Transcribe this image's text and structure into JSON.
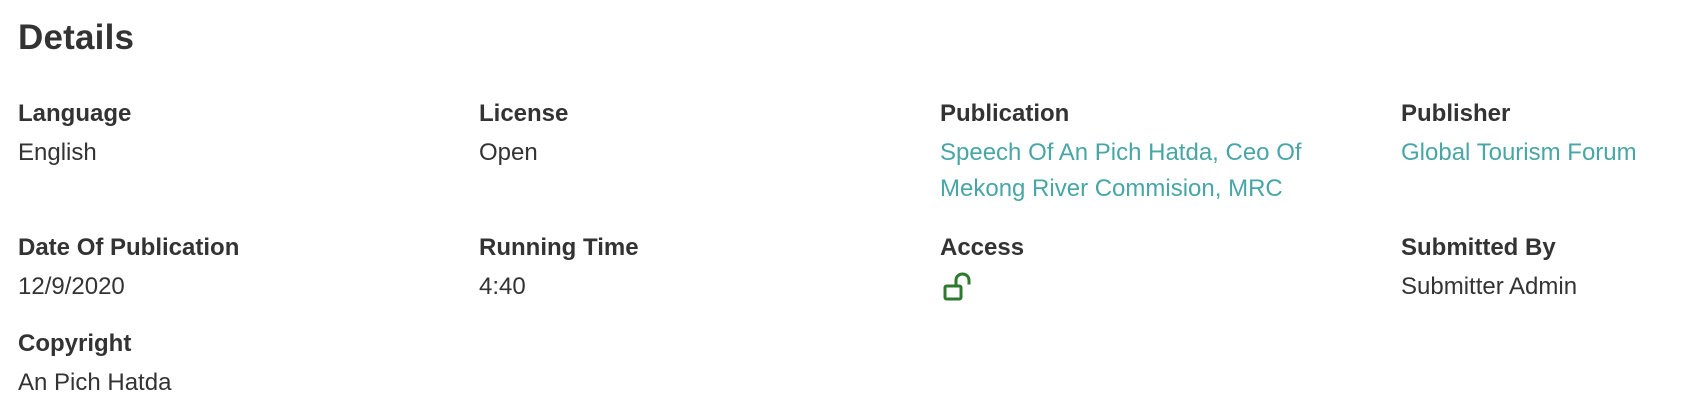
{
  "section": {
    "title": "Details"
  },
  "fields": {
    "language": {
      "label": "Language",
      "value": "English"
    },
    "license": {
      "label": "License",
      "value": "Open"
    },
    "publication": {
      "label": "Publication",
      "value": "Speech Of An Pich Hatda, Ceo Of Mekong River Commision, MRC"
    },
    "publisher": {
      "label": "Publisher",
      "value": "Global Tourism Forum"
    },
    "date_of_publication": {
      "label": "Date Of Publication",
      "value": "12/9/2020"
    },
    "running_time": {
      "label": "Running Time",
      "value": "4:40"
    },
    "access": {
      "label": "Access",
      "icon": "unlock-icon",
      "status_color": "#2d7a2d"
    },
    "submitted_by": {
      "label": "Submitted By",
      "value": "Submitter Admin"
    },
    "copyright": {
      "label": "Copyright",
      "value": "An Pich Hatda"
    }
  },
  "colors": {
    "heading": "#333333",
    "link": "#48a6a6",
    "access_icon": "#2d7a2d"
  }
}
